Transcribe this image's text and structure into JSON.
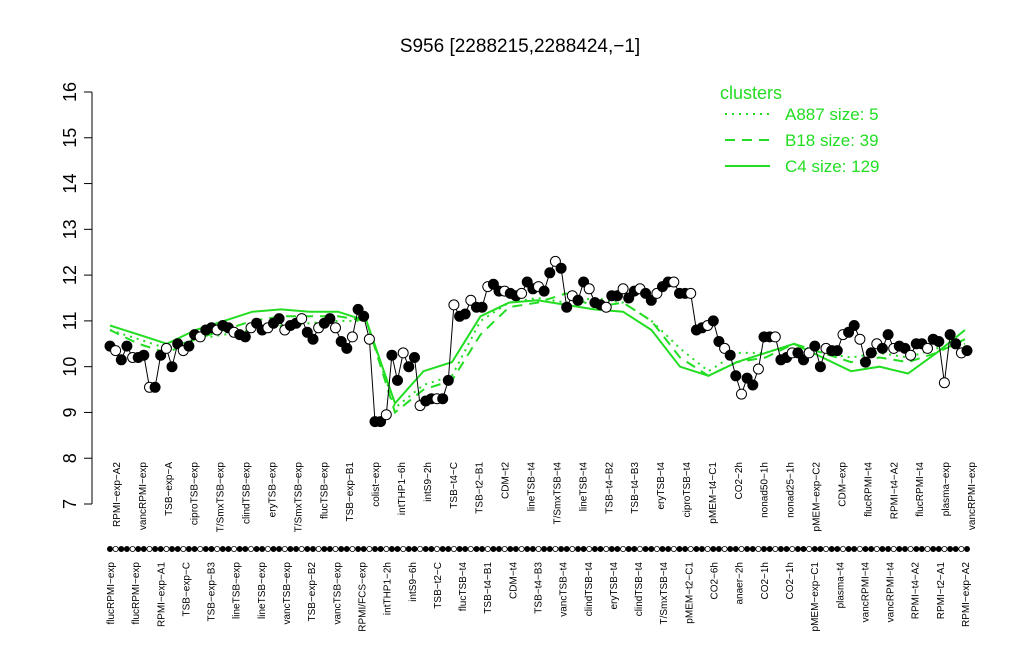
{
  "chart_data": {
    "type": "line",
    "title": "S956 [2288215,2288424,−1]",
    "ylim": [
      7,
      16
    ],
    "yticks": [
      7,
      8,
      9,
      10,
      11,
      12,
      13,
      14,
      15,
      16
    ],
    "legend": {
      "title": "clusters",
      "placement": "top-right",
      "entries": [
        {
          "label": "A887 size: 5",
          "style": "dotted"
        },
        {
          "label": "B18 size: 39",
          "style": "dashed"
        },
        {
          "label": "C4 size: 129",
          "style": "solid"
        }
      ]
    },
    "xlabels_top": [
      "RPMI−exp−A2",
      "vancRPMI−exp",
      "TSB−exp−A",
      "ciproTSB−exp",
      "T/SmxTSB−exp",
      "clindTSB−exp",
      "eryTSB−exp",
      "T/SmxTSB−exp",
      "flucTSB−exp",
      "TSB−exp−B1",
      "colist−exp",
      "intTHP1−6h",
      "intS9−2h",
      "TSB−t4−C",
      "TSB−t2−B1",
      "CDM−t2",
      "lineTSB−t4",
      "T/SmxTSB−t4",
      "lineTSB−t4",
      "TSB−t4−B2",
      "TSB−t4−B3",
      "eryTSB−t4",
      "ciproTSB−t4",
      "pMEM−t4−C1",
      "CO2−2h",
      "nonad50−1h",
      "nonad25−1h",
      "pMEM−exp−C2",
      "CDM−exp",
      "flucRPMI−t4",
      "RPMI−t4−A2",
      "flucRPMI−t4",
      "plasma−exp",
      "vancRPMI−exp"
    ],
    "xlabels_bottom": [
      "flucRPMI−exp",
      "flucRPMI−exp",
      "RPMI−exp−A1",
      "TSB−exp−C",
      "TSB−exp−B3",
      "lineTSB−exp",
      "lineTSB−exp",
      "vancTSB−exp",
      "TSB−exp−B2",
      "vancTSB−exp",
      "RPMI/FCS−exp",
      "intTHP1−2h",
      "intS9−6h",
      "TSB−t2−C",
      "flucTSB−t4",
      "TSB−t4−B1",
      "CDM−t4",
      "TSB−t4−B3",
      "vancTSB−t4",
      "clindTSB−t4",
      "eryTSB−t4",
      "clindTSB−t4",
      "T/SmxTSB−t4",
      "pMEM−t2−C1",
      "CO2−6h",
      "anaer−2h",
      "CO2−1h",
      "CO2−1h",
      "pMEM−exp−C1",
      "plasma−t4",
      "vancRPMI−t4",
      "vancRPMI−t4",
      "RPMI−t4−A2",
      "RPMI−t2−A1",
      "RPMI−exp−A2"
    ],
    "series": [
      {
        "style": "points",
        "values": [
          10.45,
          10.35,
          10.15,
          10.45,
          10.2,
          10.2,
          10.25,
          9.55,
          9.55,
          10.25,
          10.4,
          10.0,
          10.5,
          10.35,
          10.45,
          10.7,
          10.65,
          10.8,
          10.85,
          10.8,
          10.9,
          10.85,
          10.75,
          10.7,
          10.65,
          10.85,
          10.95,
          10.8,
          10.85,
          10.95,
          11.05,
          10.8,
          10.9,
          10.95,
          11.05,
          10.75,
          10.6,
          10.85,
          10.95,
          11.05,
          10.85,
          10.55,
          10.4,
          10.65,
          11.25,
          11.1,
          10.6,
          8.8,
          8.8,
          8.95,
          10.25,
          9.7,
          10.3,
          10.0,
          10.2,
          9.15,
          9.25,
          9.3,
          9.3,
          9.3,
          9.7,
          11.35,
          11.1,
          11.15,
          11.45,
          11.3,
          11.3,
          11.75,
          11.8,
          11.65,
          11.65,
          11.6,
          11.55,
          11.6,
          11.85,
          11.7,
          11.75,
          11.65,
          12.05,
          12.3,
          12.15,
          11.3,
          11.55,
          11.45,
          11.85,
          11.7,
          11.4,
          11.35,
          11.3,
          11.55,
          11.55,
          11.7,
          11.5,
          11.65,
          11.7,
          11.6,
          11.45,
          11.6,
          11.75,
          11.85,
          11.85,
          11.6,
          11.6,
          11.6,
          10.8,
          10.85,
          10.9,
          11.0,
          10.55,
          10.4,
          10.25,
          9.8,
          9.4,
          9.75,
          9.6,
          9.95,
          10.65,
          10.65,
          10.65,
          10.15,
          10.2,
          10.3,
          10.3,
          10.15,
          10.3,
          10.45,
          10.0,
          10.4,
          10.35,
          10.35,
          10.7,
          10.75,
          10.9,
          10.6,
          10.1,
          10.3,
          10.5,
          10.4,
          10.7,
          10.4,
          10.45,
          10.4,
          10.25,
          10.5,
          10.5,
          10.4,
          10.6,
          10.55,
          9.65,
          10.7,
          10.5,
          10.3,
          10.35
        ]
      },
      {
        "name": "A887 size: 5",
        "style": "dotted",
        "values": [
          10.8,
          10.6,
          10.4,
          10.6,
          10.7,
          10.8,
          10.9,
          10.95,
          11.0,
          11.0,
          9.1,
          9.6,
          9.8,
          11.0,
          11.4,
          11.5,
          11.4,
          11.5,
          11.4,
          11.0,
          10.4,
          9.9,
          10.3,
          10.3,
          10.5,
          10.3,
          10.2,
          10.3,
          10.2,
          10.4,
          10.5
        ]
      },
      {
        "name": "B18 size: 39",
        "style": "dashed",
        "values": [
          10.8,
          10.5,
          10.3,
          10.6,
          10.8,
          11.0,
          11.1,
          11.1,
          11.1,
          11.0,
          9.0,
          9.5,
          9.7,
          10.7,
          11.3,
          11.4,
          11.6,
          11.3,
          11.4,
          11.0,
          10.2,
          9.8,
          10.1,
          10.2,
          10.5,
          10.3,
          10.1,
          10.2,
          10.1,
          10.3,
          10.6
        ]
      },
      {
        "name": "C4 size: 129",
        "style": "solid",
        "values": [
          10.9,
          10.7,
          10.5,
          10.8,
          11.0,
          11.2,
          11.25,
          11.2,
          11.2,
          11.0,
          9.2,
          9.9,
          10.1,
          11.1,
          11.4,
          11.45,
          11.35,
          11.25,
          11.2,
          10.8,
          10.0,
          9.8,
          10.1,
          10.3,
          10.5,
          10.2,
          9.9,
          10.0,
          9.85,
          10.3,
          10.8
        ]
      }
    ]
  },
  "colors": {
    "cluster": "#22dd22",
    "points_fill": "#000000",
    "points_alt_fill": "#ffffff",
    "axis": "#000000"
  }
}
